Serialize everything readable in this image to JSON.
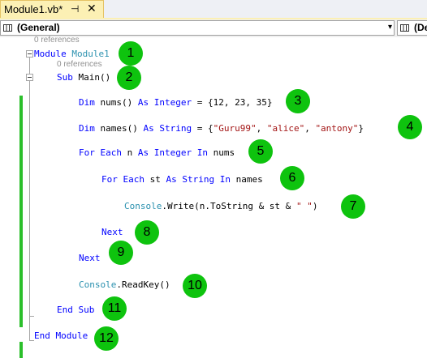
{
  "tab": {
    "title": "Module1.vb*",
    "pin_icon": "pin-icon",
    "close_icon": "close-icon",
    "pin_glyph": "⊣",
    "close_glyph": "✕"
  },
  "navbar": {
    "left_combo": "(General)",
    "right_combo": "(De",
    "arrow_glyph": "▾"
  },
  "code": {
    "ref0": "0 references",
    "ref1": "0 references",
    "l1": {
      "kw": "Module",
      "name": "Module1"
    },
    "l2": {
      "kw": "Sub",
      "rest": "Main()"
    },
    "l3": {
      "kw1": "Dim",
      "mid": "nums()",
      "kw2": "As Integer",
      "rest": "= {12, 23, 35}"
    },
    "l4": {
      "kw1": "Dim",
      "mid": "names()",
      "kw2": "As String",
      "eq": "= {",
      "s1": "\"Guru99\"",
      "c1": ", ",
      "s2": "\"alice\"",
      "c2": ", ",
      "s3": "\"antony\"",
      "end": "}"
    },
    "l5": {
      "kw1": "For Each",
      "mid": "n",
      "kw2": "As Integer In",
      "rest": "nums"
    },
    "l6": {
      "kw1": "For Each",
      "mid": "st",
      "kw2": "As String In",
      "rest": "names"
    },
    "l7": {
      "cls": "Console",
      "rest": ".Write(n.ToString & st & ",
      "str": "\" \"",
      "end": ")"
    },
    "l8": {
      "kw": "Next"
    },
    "l9": {
      "kw": "Next"
    },
    "l10": {
      "cls": "Console",
      "rest": ".ReadKey()"
    },
    "l11": {
      "kw": "End Sub"
    },
    "l12": {
      "kw": "End Module"
    }
  },
  "badges": [
    "1",
    "2",
    "3",
    "4",
    "5",
    "6",
    "7",
    "8",
    "9",
    "10",
    "11",
    "12"
  ],
  "colors": {
    "keyword": "#0000ff",
    "type": "#2b91af",
    "string": "#a31515",
    "badge": "#0ec30e",
    "changebar": "#2bbf2b",
    "tab": "#fcf0b4"
  }
}
